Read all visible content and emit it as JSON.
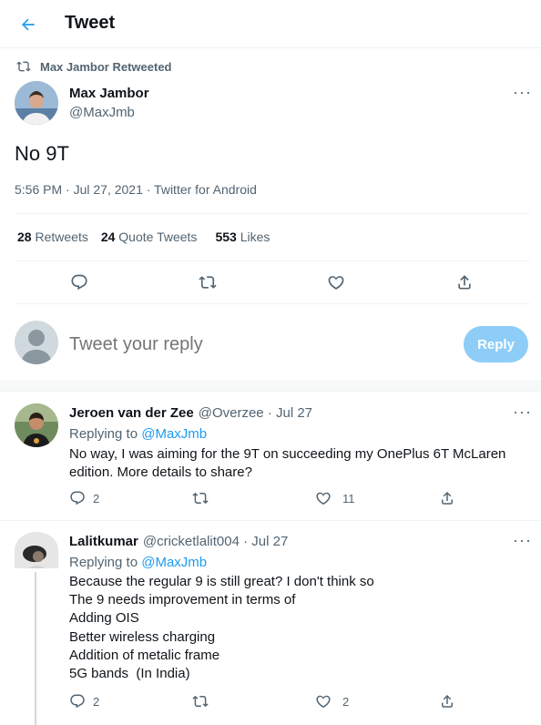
{
  "header": {
    "title": "Tweet"
  },
  "tweet": {
    "retweeted_by": "Max Jambor Retweeted",
    "author_name": "Max Jambor",
    "author_handle": "@MaxJmb",
    "text": "No 9T",
    "meta": "5:56 PM · Jul 27, 2021 · Twitter for Android",
    "stats": {
      "retweets": "28",
      "retweets_label": "Retweets",
      "quotes": "24",
      "quotes_label": "Quote Tweets",
      "likes": "553",
      "likes_label": "Likes"
    }
  },
  "compose": {
    "placeholder": "Tweet your reply",
    "button_label": "Reply"
  },
  "replies": [
    {
      "name": "Jeroen van der Zee",
      "handle_date": "@Overzee · Jul 27",
      "replying_label": "Replying to",
      "replying_to": "@MaxJmb",
      "lines": [
        "No way, I was aiming for the 9T on succeeding my OnePlus 6T McLaren",
        "edition. More details to share?"
      ],
      "reply_count": "2",
      "retweet_count": "",
      "like_count": "11"
    },
    {
      "name": "Lalitkumar",
      "handle_date": "@cricketlalit004 · Jul 27",
      "replying_label": "Replying to",
      "replying_to": "@MaxJmb",
      "lines": [
        "Because the regular 9 is still great? I don't think so",
        "The 9 needs improvement in terms of",
        "Adding OIS",
        "Better wireless charging",
        "Addition of metalic frame",
        "5G bands  (In India)"
      ],
      "reply_count": "2",
      "retweet_count": "",
      "like_count": "2"
    }
  ],
  "colors": {
    "accent": "#1d9bf0",
    "reply_button_disabled": "#8ecdf8",
    "divider": "#eff3f4",
    "section_gap": "#f7f9f9",
    "muted": "#536471"
  },
  "icons": [
    "back-arrow-icon",
    "retweet-icon",
    "more-icon",
    "reply-icon",
    "like-icon",
    "share-icon",
    "default-avatar-icon"
  ]
}
